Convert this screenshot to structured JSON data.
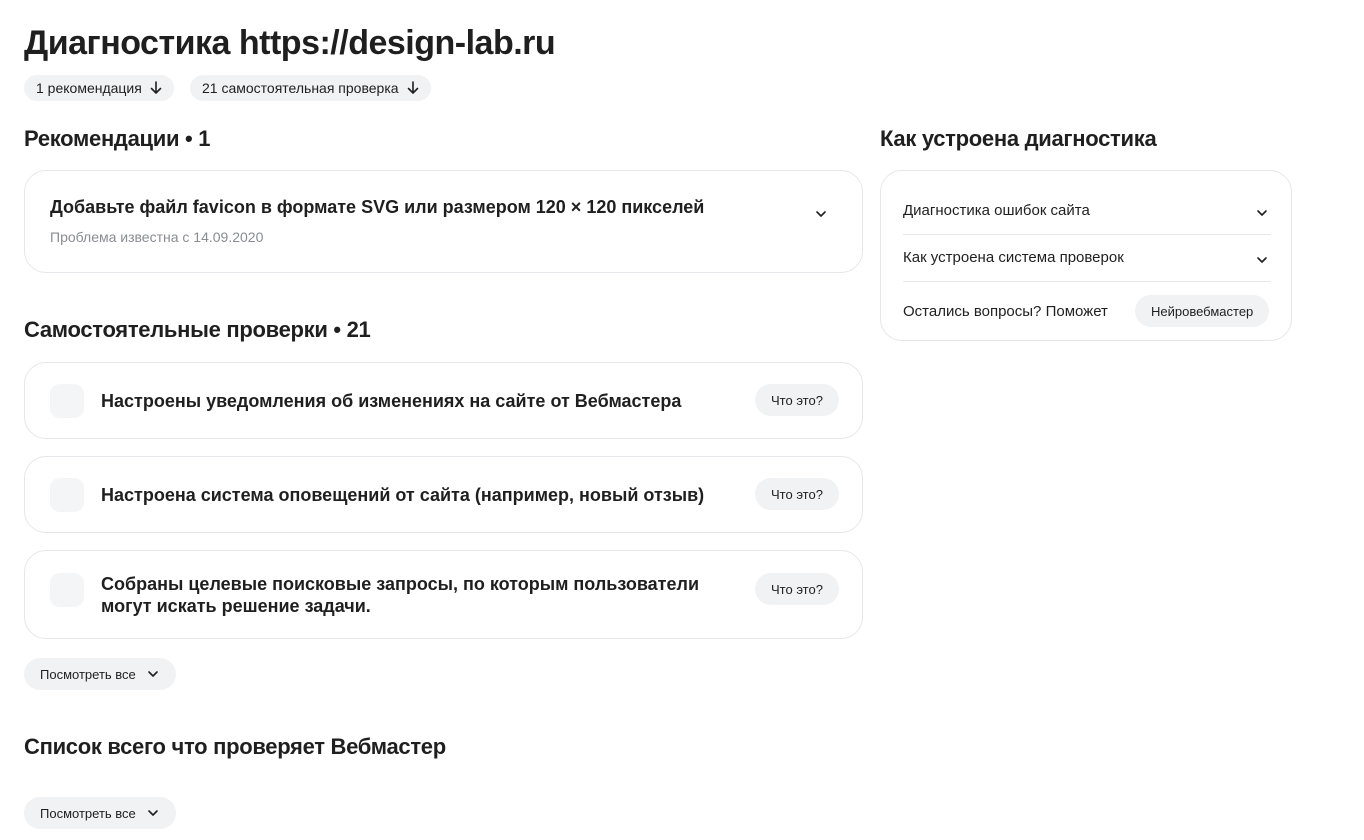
{
  "header": {
    "title": "Диагностика https://design-lab.ru",
    "chips": [
      {
        "label": "1 рекомендация"
      },
      {
        "label": "21 самостоятельная проверка"
      }
    ]
  },
  "recommendations": {
    "heading": "Рекомендации • 1",
    "items": [
      {
        "title": "Добавьте файл favicon в формате SVG или размером 120 × 120 пикселей",
        "subtitle": "Проблема известна с 14.09.2020"
      }
    ]
  },
  "checks": {
    "heading": "Самостоятельные проверки • 21",
    "items": [
      {
        "text": "Настроены уведомления об изменениях на сайте от Вебмастера",
        "button": "Что это?"
      },
      {
        "text": "Настроена система оповещений от сайта (например, новый отзыв)",
        "button": "Что это?"
      },
      {
        "text": "Собраны целевые поисковые запросы, по которым пользователи могут искать решение задачи.",
        "button": "Что это?"
      }
    ],
    "view_all": "Посмотреть все"
  },
  "all_checks": {
    "heading": "Список всего что проверяет Вебмастер",
    "view_all": "Посмотреть все"
  },
  "sidebar": {
    "heading": "Как устроена диагностика",
    "rows": [
      {
        "label": "Диагностика ошибок сайта"
      },
      {
        "label": "Как устроена система проверок"
      }
    ],
    "help_text": "Остались вопросы? Поможет",
    "help_button": "Нейровебмастер"
  },
  "icons": {
    "arrow_down": "arrow-down-icon",
    "chevron": "chevron-down-icon"
  },
  "colors": {
    "background": "#ffffff",
    "chip_bg": "#f1f2f4",
    "border": "#e6e7ea",
    "muted_text": "#8a8c92"
  }
}
